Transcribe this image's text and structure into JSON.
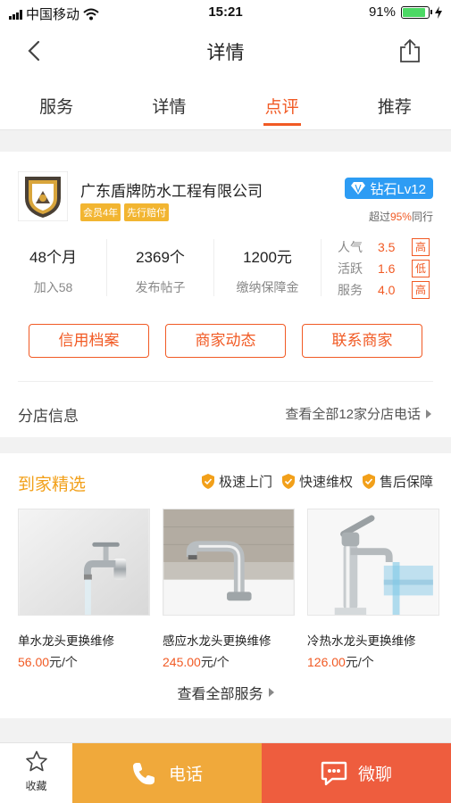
{
  "status_bar": {
    "carrier": "中国移动",
    "time": "15:21",
    "battery": "91%",
    "battery_level": 0.91
  },
  "nav": {
    "title": "详情",
    "back_icon": "chevron-left-icon",
    "share_icon": "share-icon"
  },
  "tabs": [
    {
      "label": "服务",
      "active": false
    },
    {
      "label": "详情",
      "active": false
    },
    {
      "label": "点评",
      "active": true
    },
    {
      "label": "推荐",
      "active": false
    }
  ],
  "store": {
    "name": "广东盾牌防水工程有限公司",
    "badges": [
      "会员4年",
      "先行赔付"
    ],
    "level": "钻石Lv12",
    "exceed_prefix": "超过",
    "exceed_percent": "95%",
    "exceed_suffix": "同行",
    "stats": [
      {
        "value": "48个月",
        "label": "加入58"
      },
      {
        "value": "2369个",
        "label": "发布帖子"
      },
      {
        "value": "1200元",
        "label": "缴纳保障金"
      }
    ],
    "ratings": [
      {
        "label": "人气",
        "value": "3.5",
        "level": "高"
      },
      {
        "label": "活跃",
        "value": "1.6",
        "level": "低"
      },
      {
        "label": "服务",
        "value": "4.0",
        "level": "高"
      }
    ],
    "actions": [
      "信用档案",
      "商家动态",
      "联系商家"
    ],
    "branch_label": "分店信息",
    "branch_link": "查看全部12家分店电话"
  },
  "services": {
    "title": "到家精选",
    "guarantees": [
      "极速上门",
      "快速维权",
      "售后保障"
    ],
    "products": [
      {
        "name": "单水龙头更换维修",
        "price": "56.00",
        "unit": "元/个"
      },
      {
        "name": "感应水龙头更换维修",
        "price": "245.00",
        "unit": "元/个"
      },
      {
        "name": "冷热水龙头更换维修",
        "price": "126.00",
        "unit": "元/个"
      }
    ],
    "view_all": "查看全部服务"
  },
  "bottom_bar": {
    "favorite": "收藏",
    "call": "电话",
    "chat": "微聊"
  },
  "colors": {
    "accent": "#f15a24",
    "gold": "#f2a01a",
    "call": "#f0a93b",
    "chat": "#ee5d3e",
    "level_blue": "#2d9cf4"
  }
}
